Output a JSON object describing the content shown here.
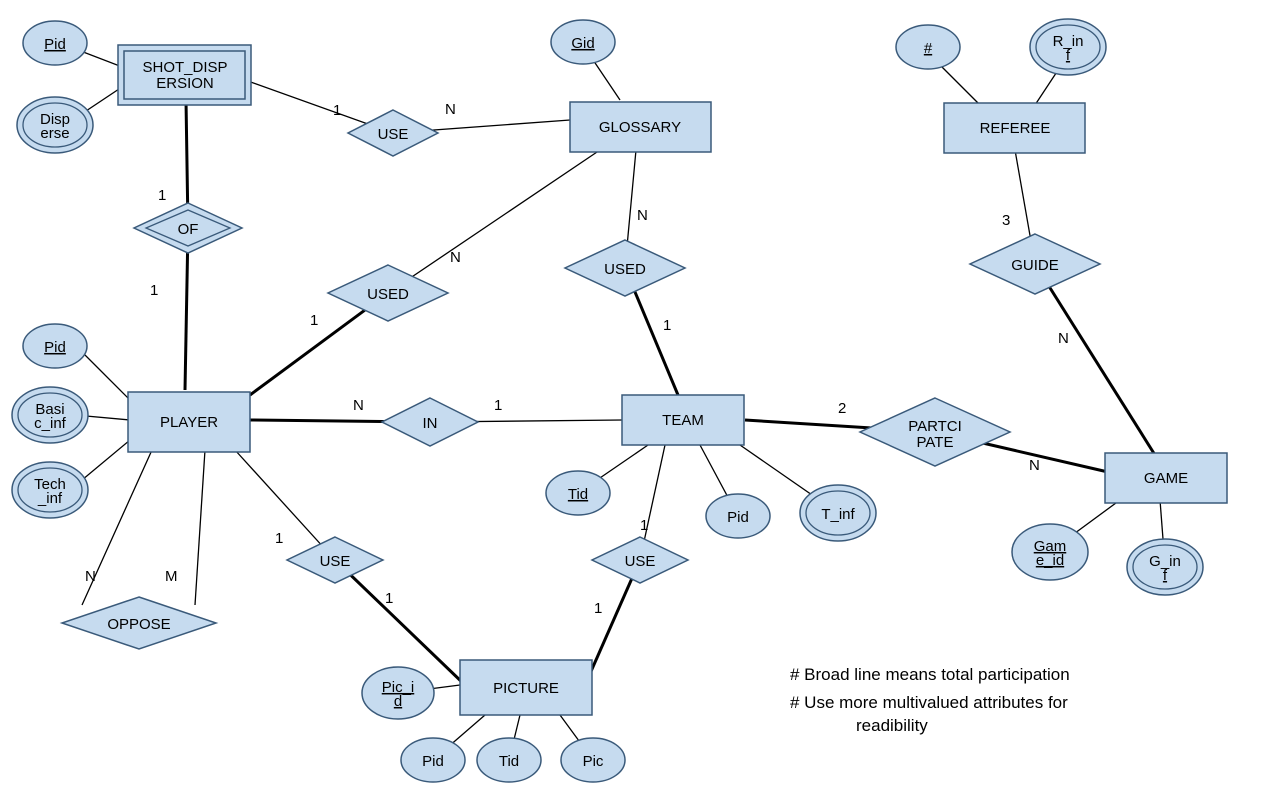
{
  "entities": {
    "shot_dispersion": "SHOT_DISPERSION",
    "glossary": "GLOSSARY",
    "referee": "REFEREE",
    "player": "PLAYER",
    "team": "TEAM",
    "game": "GAME",
    "picture": "PICTURE"
  },
  "relationships": {
    "use1": "USE",
    "of": "OF",
    "used1": "USED",
    "used2": "USED",
    "in": "IN",
    "guide": "GUIDE",
    "participate": "PARTCIPATE",
    "oppose": "OPPOSE",
    "use2": "USE",
    "use3": "USE"
  },
  "attributes": {
    "pid_sd": "Pid",
    "disperse": "Disperse",
    "gid": "Gid",
    "ref_num": "#",
    "r_inf": "R_inf",
    "pid_player": "Pid",
    "basic_inf": "Basic_inf",
    "tech_inf": "Tech_inf",
    "tid": "Tid",
    "pid_team": "Pid",
    "t_inf": "T_inf",
    "game_id": "Game_id",
    "g_inf": "G_inf",
    "pic_id": "Pic_id",
    "pid_pic": "Pid",
    "tid_pic": "Tid",
    "pic": "Pic"
  },
  "cardinalities": {
    "c_sd_use": "1",
    "c_gloss_use": "N",
    "c_sd_of": "1",
    "c_player_of": "1",
    "c_gloss_used1": "N",
    "c_player_used1": "1",
    "c_gloss_used2": "N",
    "c_team_used2": "1",
    "c_player_in": "N",
    "c_team_in": "1",
    "c_ref_guide": "3",
    "c_game_guide": "N",
    "c_team_part": "2",
    "c_game_part": "N",
    "c_oppose_n": "N",
    "c_oppose_m": "M",
    "c_player_use2": "1",
    "c_pic_use2": "1",
    "c_team_use3": "1",
    "c_pic_use3": "1"
  },
  "notes": {
    "n1": "# Broad line means  total participation",
    "n2": "# Use more multivalued attributes for",
    "n3": "readibility"
  }
}
